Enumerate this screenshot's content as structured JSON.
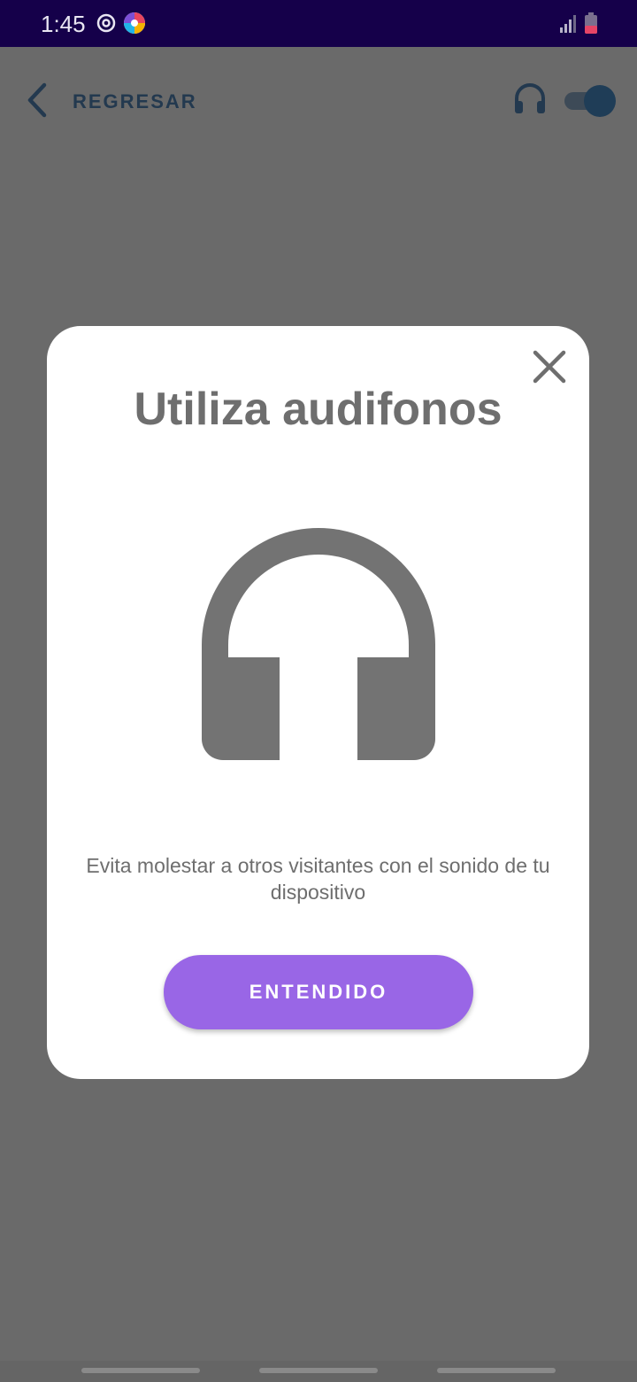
{
  "status_bar": {
    "time": "1:45",
    "icons": [
      "sync-icon",
      "app-logo-icon",
      "signal-icon",
      "battery-icon"
    ]
  },
  "header": {
    "back_label": "REGRESAR",
    "audio_icon": "headphones-icon",
    "audio_toggle_on": true
  },
  "modal": {
    "title": "Utiliza audifonos",
    "hero_icon": "headphones-icon",
    "message": "Evita molestar a otros visitantes con el sonido de tu dispositivo",
    "confirm_label": "ENTENDIDO",
    "close_icon": "close-icon"
  },
  "colors": {
    "status_bar": "#15004a",
    "overlay": "#6a6a6a",
    "accent": "#9966e6",
    "header_text": "#23394f",
    "modal_text": "#6e6e6e"
  }
}
